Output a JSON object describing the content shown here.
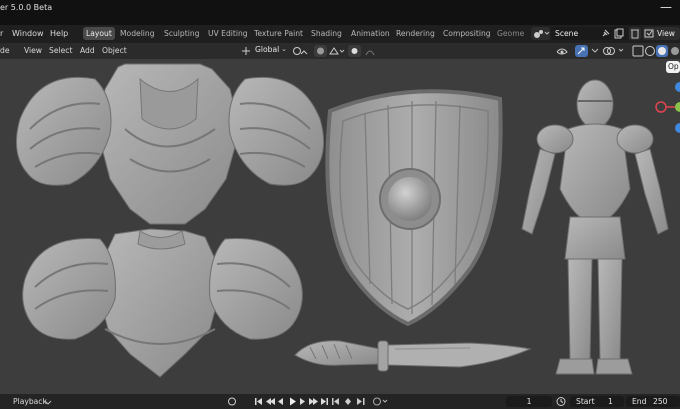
{
  "window": {
    "title": "er 5.0.0 Beta"
  },
  "menu": [
    "r",
    "Window",
    "Help"
  ],
  "workspaces": {
    "tabs": [
      "Layout",
      "Modeling",
      "Sculpting",
      "UV Editing",
      "Texture Paint",
      "Shading",
      "Animation",
      "Rendering",
      "Compositing",
      "Geome"
    ],
    "active": "Layout"
  },
  "scene": {
    "name": "Scene"
  },
  "view_layer": {
    "label": "View"
  },
  "header_menu": [
    "de",
    "View",
    "Select",
    "Add",
    "Object"
  ],
  "transform": {
    "orientation": "Global"
  },
  "tooltip": {
    "text": "Op"
  },
  "timeline": {
    "playback": "Playback",
    "current_frame": "1",
    "start_label": "Start",
    "start": "1",
    "end_label": "End",
    "end": "250"
  },
  "icons": {
    "scene": "scene-icon",
    "pin": "pin-icon",
    "new_scene": "new-scene-icon",
    "delete": "delete-icon",
    "view_layer": "view-layer-icon",
    "gizmo": "gizmo-icon",
    "shading": "shading-icon",
    "snap": "snap-icon",
    "proportional": "proportional-editing-icon",
    "record": "record-icon",
    "jump_start": "jump-start-icon",
    "play": "play-icon",
    "jump_end": "jump-end-icon"
  },
  "colors": {
    "accent": "#4772b3",
    "x_axis": "#e0454f",
    "y_axis": "#8bc34a",
    "z_axis": "#3f8ae0"
  }
}
